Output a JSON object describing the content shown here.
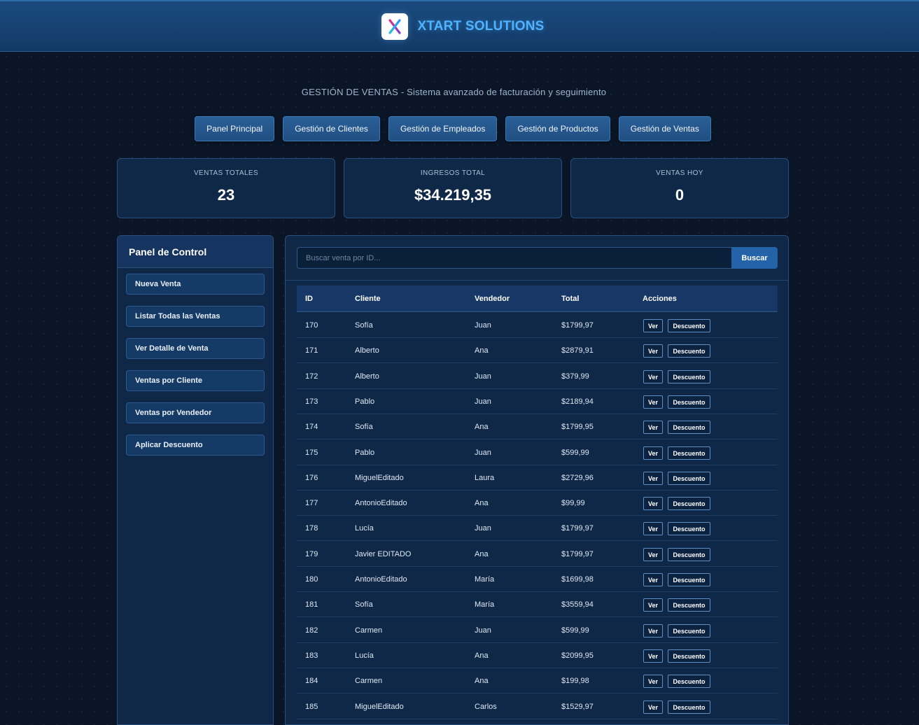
{
  "header": {
    "brand_name": "XTART SOLUTIONS",
    "logo_icon": "x-logo-icon"
  },
  "subtitle": "GESTIÓN DE VENTAS - Sistema avanzado de facturación y seguimiento",
  "nav": [
    "Panel Principal",
    "Gestión de Clientes",
    "Gestión de Empleados",
    "Gestión de Productos",
    "Gestión de Ventas"
  ],
  "stats": [
    {
      "label": "VENTAS TOTALES",
      "value": "23"
    },
    {
      "label": "INGRESOS TOTAL",
      "value": "$34.219,35"
    },
    {
      "label": "VENTAS HOY",
      "value": "0"
    }
  ],
  "sidebar": {
    "title": "Panel de Control",
    "items": [
      "Nueva Venta",
      "Listar Todas las Ventas",
      "Ver Detalle de Venta",
      "Ventas por Cliente",
      "Ventas por Vendedor",
      "Aplicar Descuento"
    ]
  },
  "search": {
    "placeholder": "Buscar venta por ID...",
    "button": "Buscar"
  },
  "table": {
    "headers": [
      "ID",
      "Cliente",
      "Vendedor",
      "Total",
      "Acciones"
    ],
    "action_labels": {
      "view": "Ver",
      "discount": "Descuento"
    },
    "rows": [
      [
        "170",
        "Sofía",
        "Juan",
        "$1799,97"
      ],
      [
        "171",
        "Alberto",
        "Ana",
        "$2879,91"
      ],
      [
        "172",
        "Alberto",
        "Juan",
        "$379,99"
      ],
      [
        "173",
        "Pablo",
        "Juan",
        "$2189,94"
      ],
      [
        "174",
        "Sofía",
        "Ana",
        "$1799,95"
      ],
      [
        "175",
        "Pablo",
        "Juan",
        "$599,99"
      ],
      [
        "176",
        "MiguelEditado",
        "Laura",
        "$2729,96"
      ],
      [
        "177",
        "AntonioEditado",
        "Ana",
        "$99,99"
      ],
      [
        "178",
        "Lucía",
        "Juan",
        "$1799,97"
      ],
      [
        "179",
        "Javier EDITADO",
        "Ana",
        "$1799,97"
      ],
      [
        "180",
        "AntonioEditado",
        "María",
        "$1699,98"
      ],
      [
        "181",
        "Sofía",
        "María",
        "$3559,94"
      ],
      [
        "182",
        "Carmen",
        "Juan",
        "$599,99"
      ],
      [
        "183",
        "Lucía",
        "Ana",
        "$2099,95"
      ],
      [
        "184",
        "Carmen",
        "Ana",
        "$199,98"
      ],
      [
        "185",
        "MiguelEditado",
        "Carlos",
        "$1529,97"
      ]
    ]
  },
  "colors": {
    "background": "#0a1627",
    "accent": "#4fb3ff",
    "button": "#2563a8"
  }
}
